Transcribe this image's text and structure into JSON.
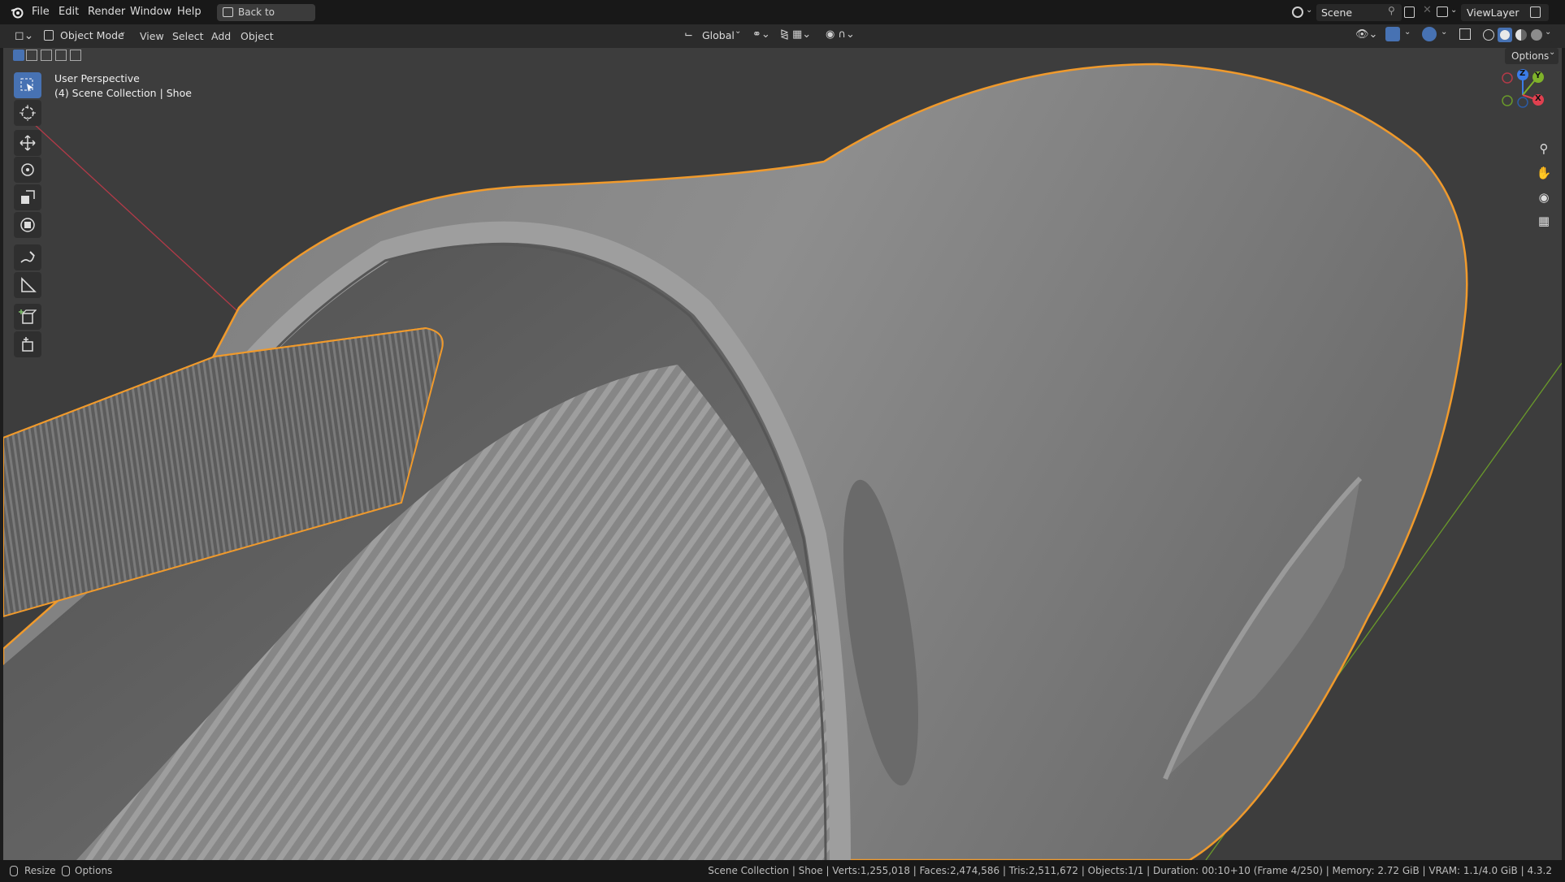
{
  "menubar": {
    "items": [
      "File",
      "Edit",
      "Render",
      "Window",
      "Help"
    ],
    "back_button": "Back to Previous",
    "scene_name": "Scene",
    "view_layer": "ViewLayer"
  },
  "header": {
    "mode": "Object Mode",
    "menus": [
      "View",
      "Select",
      "Add",
      "Object"
    ],
    "transform_orientation": "Global",
    "options_label": "Options"
  },
  "viewport": {
    "perspective_label": "User Perspective",
    "collection_label": "(4) Scene Collection | Shoe",
    "gizmo": {
      "z": "Z",
      "y": "Y",
      "x": "X"
    }
  },
  "statusbar": {
    "left": [
      "Resize",
      "Options"
    ],
    "info": "Scene Collection | Shoe | Verts:1,255,018 | Faces:2,474,586 | Tris:2,511,672 | Objects:1/1 | Duration: 00:10+10 (Frame 4/250) | Memory: 2.72 GiB | VRAM: 1.1/4.0 GiB | 4.3.2"
  },
  "colors": {
    "accent": "#4772b3",
    "selection_outline": "#f09a2c",
    "axis_x": "#e0404f",
    "axis_y": "#7fb22a",
    "axis_z": "#3b7ce8"
  },
  "icons": [
    "blender-icon",
    "back-icon",
    "scene-icon",
    "pin-icon",
    "copy-icon",
    "viewlayer-icon",
    "editor-type-icon",
    "object-mode-icon",
    "transform-pivot-icon",
    "snap-icon",
    "proportional-icon",
    "visibility-icon",
    "gizmo-icon",
    "overlay-icon",
    "xray-icon",
    "wireframe-shading-icon",
    "solid-shading-icon",
    "material-shading-icon",
    "rendered-shading-icon",
    "select-box-icon",
    "cursor-icon",
    "move-icon",
    "rotate-icon",
    "scale-icon",
    "transform-icon",
    "annotate-icon",
    "measure-icon",
    "add-cube-icon",
    "extrude-icon",
    "zoom-icon",
    "pan-hand-icon",
    "camera-icon",
    "grid-icon",
    "mouse-icon"
  ]
}
